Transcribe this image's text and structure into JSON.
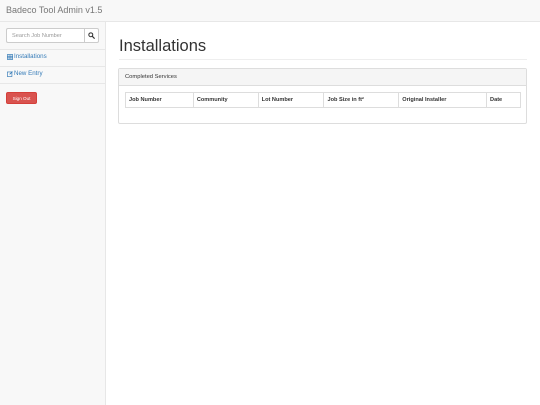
{
  "app": {
    "title": "Badeco Tool Admin v1.5"
  },
  "sidebar": {
    "search": {
      "placeholder": "Search Job Number",
      "value": "",
      "button_icon": "search-icon"
    },
    "items": [
      {
        "label": "Installations",
        "icon": "table-icon"
      },
      {
        "label": "New Entry",
        "icon": "edit-icon"
      }
    ],
    "signout_label": "Sign Out"
  },
  "main": {
    "page_title": "Installations",
    "panel": {
      "heading": "Completed Services",
      "columns": [
        "Job Number",
        "Community",
        "Lot Number",
        "Job Size in ft²",
        "Original Installer",
        "Date"
      ],
      "rows": []
    }
  },
  "colors": {
    "link": "#337ab7",
    "danger": "#d9534f",
    "navbar_bg": "#f8f8f8",
    "panel_heading_bg": "#f5f5f5"
  }
}
